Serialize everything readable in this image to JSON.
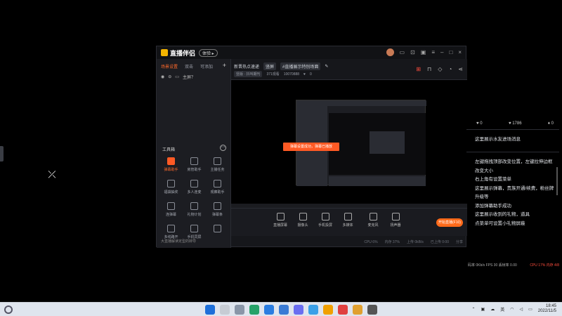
{
  "app": {
    "title": "直播伴侣",
    "version_badge": "体验 ▸",
    "left_tabs": [
      "场景设置",
      "双击",
      "可添加"
    ],
    "scene_label": "主屏？",
    "toolbox_title": "工具箱",
    "tools": [
      {
        "label": "弹幕助手",
        "hot": true
      },
      {
        "label": "房管助手"
      },
      {
        "label": "主播任务"
      },
      {
        "label": "福袋抽奖"
      },
      {
        "label": "多人连麦"
      },
      {
        "label": "观察助手"
      },
      {
        "label": "连弹幕"
      },
      {
        "label": "礼物计划"
      },
      {
        "label": "弹幕条"
      },
      {
        "label": "多线路开"
      },
      {
        "label": "手机同屏"
      },
      {
        "label": ""
      }
    ],
    "left_bottom": "大直播解读定型的转导",
    "top_row1": [
      "新晋热点速递",
      "竖屏",
      "#直播展示特别场面"
    ],
    "top_row2": [
      "竖版 · 抖叫期刊",
      "371观看",
      "10070888",
      "0"
    ],
    "toast": "弹幕设置成功，弹幕已播放",
    "controls": [
      "直播屏幕",
      "摄像头",
      "手机投屏",
      "多媒体",
      "麦克风",
      "扬声器"
    ],
    "start_button": "开始直播(F10)",
    "status_items": [
      "CPU 6%",
      "内存 37%",
      "上传 0kB/s",
      "已上传 0:00",
      "分享"
    ]
  },
  "chat": {
    "stats": [
      "0",
      "1786",
      "0"
    ],
    "top_message": "这里展示水友进场消息",
    "messages": [
      "左键拖拽顶部改变位置，左键拉伸边框改变大小",
      "右上角有设置菜单",
      "这里展示弹幕，贵族开通/续费，粉丝牌升级等",
      "添加弹幕助手成功",
      "这里展示收到的礼物，道具",
      "点菜单可设置小礼物屏蔽"
    ],
    "status_left": "码率 0Kb/s  FPS 30  丢帧率 0.00",
    "status_right": "CPU 17%  内存 4/8"
  },
  "taskbar": {
    "tray_lang": "英",
    "time": "18:45",
    "date": "2022/11/5"
  }
}
